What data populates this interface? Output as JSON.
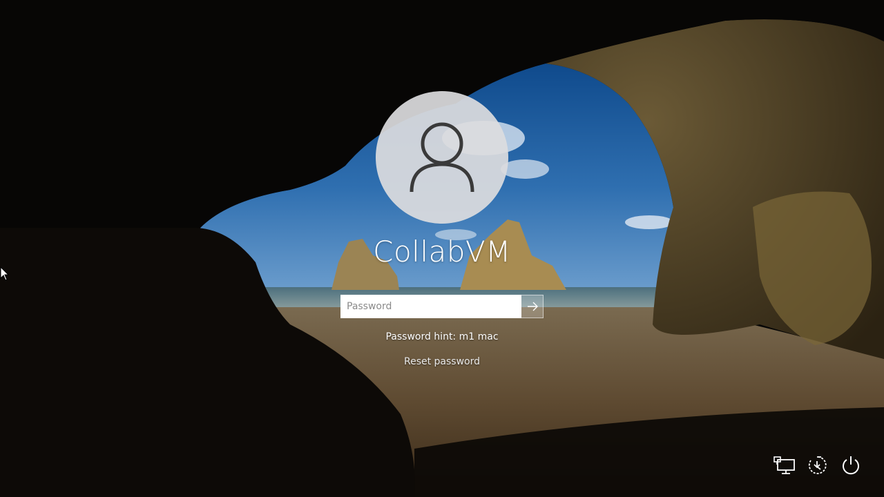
{
  "lock_screen": {
    "user_name": "CollabVM",
    "password_placeholder": "Password",
    "password_value": "",
    "password_hint": "Password hint: m1 mac",
    "reset_password_label": "Reset password"
  },
  "system_buttons": [
    {
      "name": "network",
      "icon": "network-icon"
    },
    {
      "name": "ease-of-access",
      "icon": "ease-of-access-icon"
    },
    {
      "name": "power",
      "icon": "power-icon"
    }
  ],
  "colors": {
    "text": "#ffffff",
    "avatar_bg": "#dcdcde",
    "avatar_glyph": "#3a3a3a",
    "input_bg": "#ffffff"
  }
}
